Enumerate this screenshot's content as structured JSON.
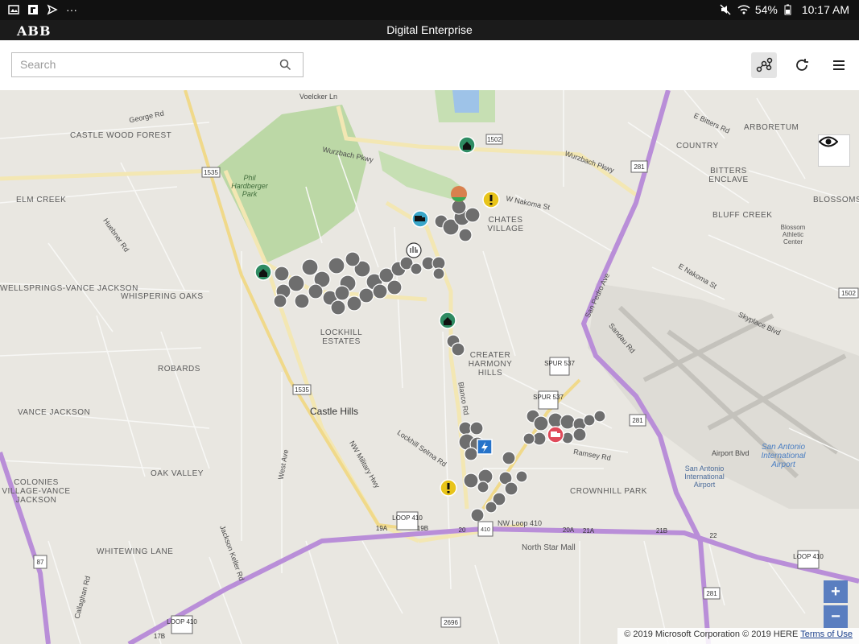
{
  "status": {
    "time": "10:17 AM",
    "battery": "54%"
  },
  "app": {
    "logo": "ABB",
    "title": "Digital Enterprise"
  },
  "search": {
    "placeholder": "Search"
  },
  "map": {
    "labels": [
      "CASTLE WOOD FOREST",
      "ELM CREEK",
      "WELLSPRINGS-VANCE JACKSON",
      "WHISPERING OAKS",
      "ROBARDS",
      "VANCE JACKSON",
      "OAK VALLEY",
      "COLONIES VILLAGE-VANCE JACKSON",
      "WHITEWING LANE",
      "LOCKHILL ESTATES",
      "CREATER HARMONY HILLS",
      "CHATES VILLAGE",
      "ARBORETUM",
      "COUNTRY",
      "BITTERS ENCLAVE",
      "BLUFF CREEK",
      "BLOSSOMS",
      "CROWNHILL PARK",
      "Castle Hills",
      "North Star Mall",
      "San Antonio International Airport",
      "Phil Hardberger Park",
      "Blossom Athletic Center",
      "San Antonio International Airport"
    ],
    "streets": [
      "Voelcker Ln",
      "George Rd",
      "Wurzbach Pkwy",
      "Wurzbach Pkwy",
      "W Nakoma St",
      "E Nakoma St",
      "E Bitters Rd",
      "NW Loop 410",
      "NW Military Hwy",
      "Blanco Rd",
      "San Pedro Ave",
      "Lockhill Selma Rd",
      "Jackson Keller Rd",
      "West Ave",
      "Airport Blvd",
      "Skyplace Blvd",
      "Sandau Rd",
      "Ramsey Rd",
      "Callaghan Rd",
      "Huebner Rd"
    ],
    "shields": [
      "1502",
      "1535",
      "281",
      "1502",
      "SPUR 537",
      "SPUR 537",
      "1535",
      "LOOP 410",
      "LOOP 410",
      "281",
      "LOOP 410",
      "87",
      "2696",
      "281",
      "19A",
      "19B",
      "20",
      "20A",
      "21A",
      "21B",
      "22",
      "17B"
    ]
  },
  "copyright": {
    "text": "© 2019 Microsoft Corporation © 2019 HERE",
    "link": "Terms of Use"
  },
  "zoom": {
    "in": "+",
    "out": "−"
  }
}
